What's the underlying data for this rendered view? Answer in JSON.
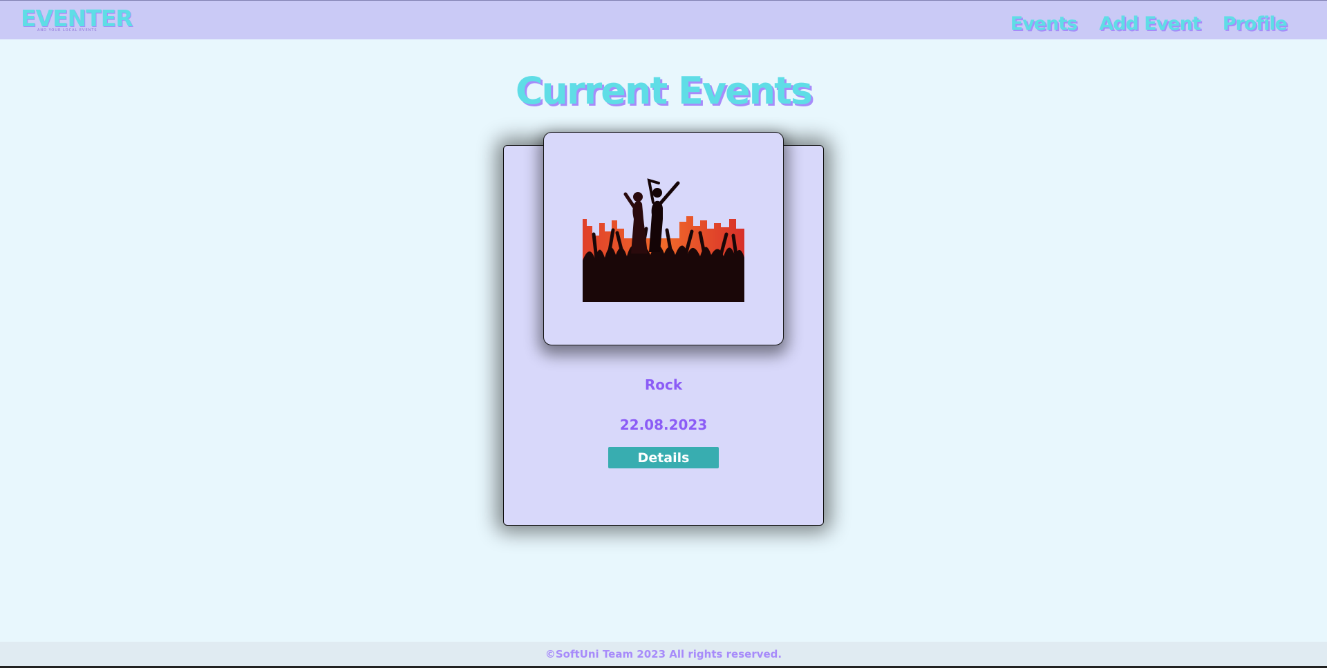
{
  "header": {
    "logo_text": "EVENTER",
    "logo_tagline": "and your local events",
    "nav": [
      {
        "label": "Events"
      },
      {
        "label": "Add Event"
      },
      {
        "label": "Profile"
      }
    ]
  },
  "main": {
    "title": "Current Events",
    "events": [
      {
        "name": "Rock",
        "date": "22.08.2023",
        "details_label": "Details"
      }
    ]
  },
  "footer": {
    "text": "©SoftUni Team 2023 All rights reserved."
  },
  "colors": {
    "header_bg": "#cacaf6",
    "page_bg": "#e8f7fd",
    "accent_cyan": "#5fdde6",
    "accent_purple": "#8b5cf6",
    "button_bg": "#38adb0",
    "card_bg": "#d8d8fa"
  }
}
